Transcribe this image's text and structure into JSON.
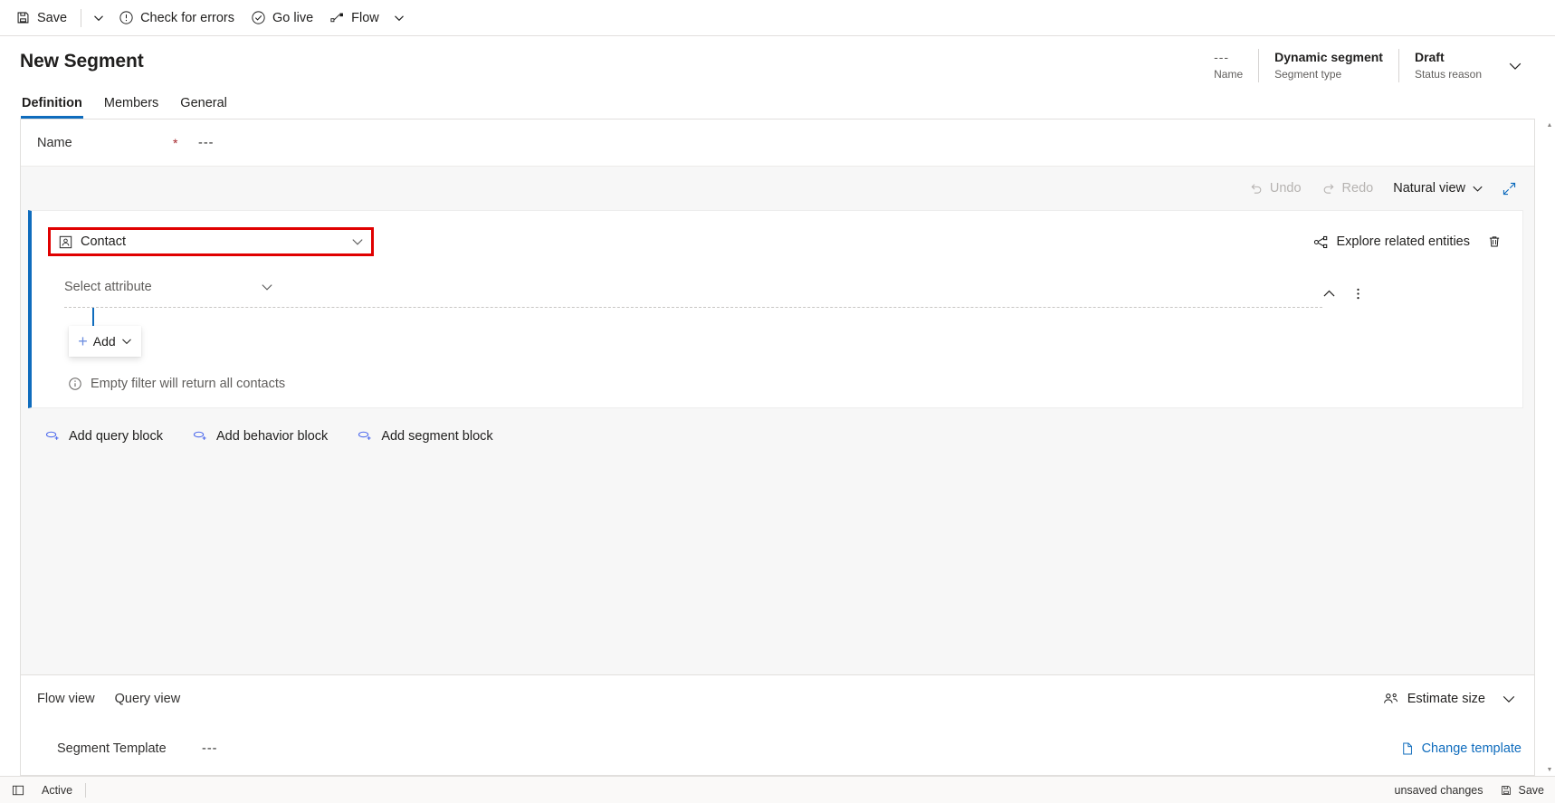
{
  "commandbar": {
    "save_label": "Save",
    "save_icon": "save-icon",
    "save_caret_icon": "chevron-down-icon",
    "check_errors_label": "Check for errors",
    "check_errors_icon": "exclamation-circle-icon",
    "go_live_label": "Go live",
    "go_live_icon": "check-circle-icon",
    "flow_label": "Flow",
    "flow_icon": "flow-icon",
    "flow_caret_icon": "chevron-down-icon"
  },
  "header": {
    "title": "New Segment",
    "meta": [
      {
        "value": "---",
        "label": "Name",
        "dim": true
      },
      {
        "value": "Dynamic segment",
        "label": "Segment type",
        "dim": false
      },
      {
        "value": "Draft",
        "label": "Status reason",
        "dim": false
      }
    ],
    "chevron_icon": "chevron-down-icon"
  },
  "tabs": [
    {
      "label": "Definition",
      "active": true
    },
    {
      "label": "Members",
      "active": false
    },
    {
      "label": "General",
      "active": false
    }
  ],
  "name_field": {
    "label": "Name",
    "required_marker": "*",
    "value": "---"
  },
  "canvas_toolbar": {
    "undo_label": "Undo",
    "undo_icon": "undo-icon",
    "redo_label": "Redo",
    "redo_icon": "redo-icon",
    "view_mode_label": "Natural view",
    "view_mode_caret_icon": "chevron-down-icon",
    "expand_icon": "expand-diagonal-icon"
  },
  "query_block": {
    "entity_icon": "contact-entity-icon",
    "entity_value": "Contact",
    "entity_caret_icon": "chevron-down-icon",
    "explore_label": "Explore related entities",
    "explore_icon": "related-entities-icon",
    "delete_icon": "trash-icon",
    "attribute_placeholder": "Select attribute",
    "attribute_caret_icon": "chevron-down-icon",
    "collapse_icon": "chevron-up-icon",
    "more_icon": "more-vertical-icon",
    "add_label": "Add",
    "add_icon": "plus-icon",
    "add_caret_icon": "chevron-down-icon",
    "hint_text": "Empty filter will return all contacts",
    "hint_icon": "info-circle-icon"
  },
  "add_blocks": [
    {
      "label": "Add query block",
      "icon": "add-block-icon"
    },
    {
      "label": "Add behavior block",
      "icon": "add-block-icon"
    },
    {
      "label": "Add segment block",
      "icon": "add-block-icon"
    }
  ],
  "bottom_panel": {
    "flow_view_label": "Flow view",
    "query_view_label": "Query view",
    "estimate_label": "Estimate size",
    "estimate_icon": "people-estimate-icon",
    "estimate_caret_icon": "chevron-down-icon",
    "template_label": "Segment Template",
    "template_value": "---",
    "change_template_label": "Change template",
    "change_template_icon": "document-icon"
  },
  "statusbar": {
    "expand_icon": "expand-pane-icon",
    "state_label": "Active",
    "unsaved_label": "unsaved changes",
    "save_label": "Save",
    "save_icon": "save-icon"
  },
  "colors": {
    "accent": "#0f6cbd",
    "highlight_border": "#e00000",
    "required": "#a4262c",
    "canvas_bg": "#f7f7f7"
  }
}
